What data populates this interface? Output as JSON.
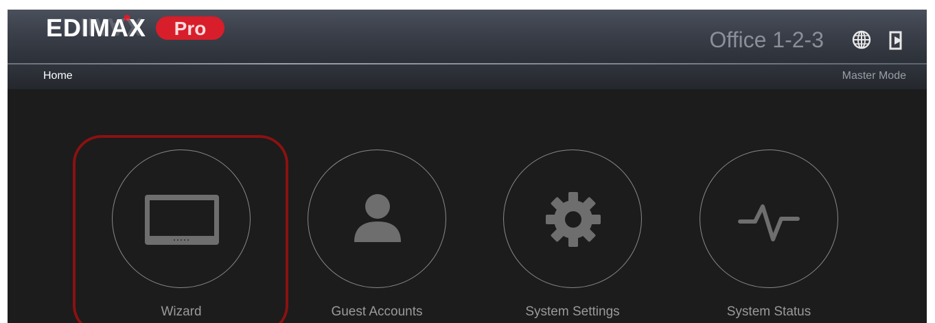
{
  "header": {
    "logo_text": "EDIMAX",
    "logo_badge": "Pro",
    "site_name": "Office 1-2-3"
  },
  "subnav": {
    "breadcrumb": "Home",
    "mode": "Master Mode"
  },
  "tiles": [
    {
      "label": "Wizard",
      "icon": "tablet-icon",
      "selected": true
    },
    {
      "label": "Guest Accounts",
      "icon": "user-icon",
      "selected": false
    },
    {
      "label": "System Settings",
      "icon": "gear-icon",
      "selected": false
    },
    {
      "label": "System Status",
      "icon": "pulse-icon",
      "selected": false
    }
  ],
  "colors": {
    "background": "#1c1c1c",
    "logo_red": "#d81e2a",
    "highlight": "#8b1111",
    "icon_gray": "#6e6e6e"
  }
}
